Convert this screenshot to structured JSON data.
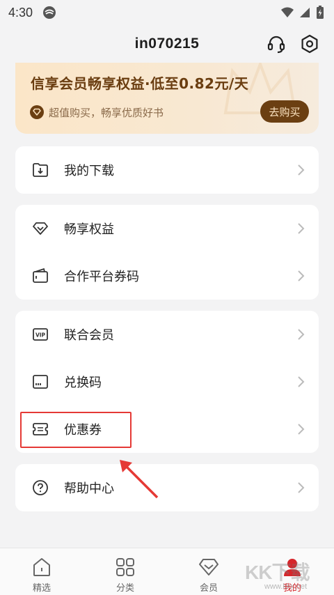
{
  "status_bar": {
    "time": "4:30"
  },
  "header": {
    "username": "in070215",
    "support_icon": "headset-icon",
    "settings_icon": "gear-icon"
  },
  "vip_banner": {
    "title": "信享会员畅享权益·低至0.82元/天",
    "subtitle": "超值购买，畅享优质好书",
    "buy_button": "去购买"
  },
  "menu": {
    "group1": [
      {
        "label": "我的下载",
        "icon": "download-folder-icon"
      }
    ],
    "group2": [
      {
        "label": "畅享权益",
        "icon": "diamond-icon"
      },
      {
        "label": "合作平台券码",
        "icon": "wallet-icon"
      }
    ],
    "group3": [
      {
        "label": "联合会员",
        "icon": "vip-card-icon"
      },
      {
        "label": "兑换码",
        "icon": "redeem-card-icon"
      },
      {
        "label": "优惠券",
        "icon": "coupon-icon"
      }
    ],
    "group4": [
      {
        "label": "帮助中心",
        "icon": "help-icon"
      }
    ]
  },
  "tabbar": {
    "tabs": [
      {
        "label": "精选",
        "icon": "home-icon"
      },
      {
        "label": "分类",
        "icon": "grid-icon"
      },
      {
        "label": "会员",
        "icon": "diamond-icon"
      },
      {
        "label": "我的",
        "icon": "profile-icon"
      }
    ],
    "active_tab": "我的"
  },
  "watermark": {
    "text": "KK下载",
    "url": "www.kkx.net"
  },
  "colors": {
    "accent_red": "#d6262b",
    "vip_brown": "#6b3f12",
    "highlight_red": "#e53935"
  }
}
